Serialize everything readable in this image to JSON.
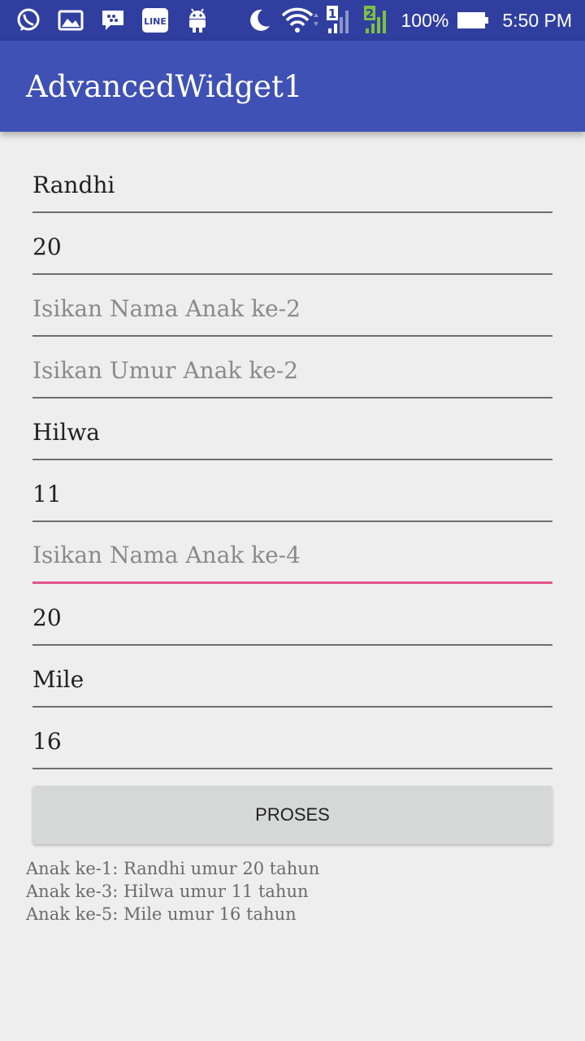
{
  "statusbar": {
    "icons": [
      "whatsapp-icon",
      "gallery-icon",
      "bbm-icon",
      "app-icon",
      "android-icon"
    ],
    "battery_percent": "100%",
    "time": "5:50 PM",
    "sim1_label": "1",
    "sim2_label": "2"
  },
  "appbar": {
    "title": "AdvancedWidget1"
  },
  "form": {
    "fields": [
      {
        "value": "Randhi",
        "placeholder": ""
      },
      {
        "value": "20",
        "placeholder": ""
      },
      {
        "value": "",
        "placeholder": "Isikan Nama Anak ke-2"
      },
      {
        "value": "",
        "placeholder": "Isikan Umur Anak ke-2"
      },
      {
        "value": "Hilwa",
        "placeholder": ""
      },
      {
        "value": "11",
        "placeholder": ""
      },
      {
        "value": "",
        "placeholder": "Isikan Nama Anak ke-4",
        "focused": true
      },
      {
        "value": "20",
        "placeholder": ""
      },
      {
        "value": "Mile",
        "placeholder": ""
      },
      {
        "value": "16",
        "placeholder": ""
      }
    ]
  },
  "button": {
    "label": "PROSES"
  },
  "result": {
    "lines": [
      "Anak ke-1: Randhi umur 20 tahun",
      "Anak ke-3: Hilwa umur 11 tahun",
      "Anak ke-5: Mile umur 16 tahun"
    ]
  },
  "colors": {
    "statusbar": "#303f9f",
    "appbar": "#3f51b5",
    "accent": "#e2548a"
  }
}
